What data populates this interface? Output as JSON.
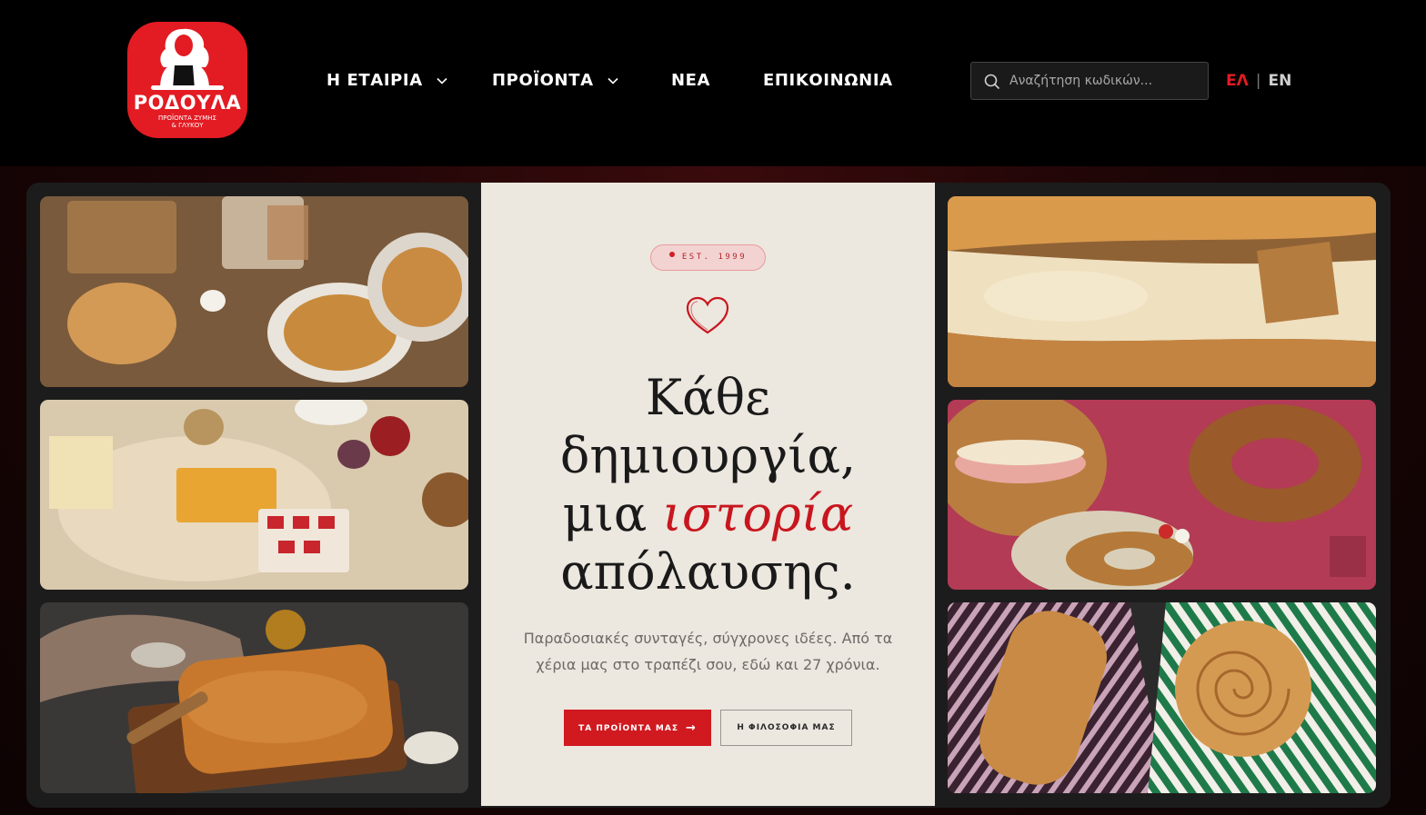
{
  "brand": {
    "name": "ΡΟΔΟΥΛΑ",
    "tagline_line1": "ΠΡΟΪΟΝΤΑ ΖΥΜΗΣ",
    "tagline_line2": "& ΓΛΥΚΟΥ",
    "color": "#e31b23"
  },
  "nav": {
    "items": [
      {
        "label": "Η ΕΤΑΙΡΙΑ",
        "has_dropdown": true
      },
      {
        "label": "ΠΡΟΪΟΝΤΑ",
        "has_dropdown": true
      },
      {
        "label": "ΝΕΑ",
        "has_dropdown": false
      },
      {
        "label": "ΕΠΙΚΟΙΝΩΝΙΑ",
        "has_dropdown": false
      }
    ]
  },
  "search": {
    "placeholder": "Αναζήτηση κωδικών...",
    "value": "",
    "icon": "search-icon"
  },
  "lang": {
    "active": "ΕΛ",
    "separator": "|",
    "other": "EN"
  },
  "hero": {
    "badge": "EST. 1999",
    "headline_line1": "Κάθε",
    "headline_line2": "δημιουργία,",
    "headline_line3_pre": "μια ",
    "headline_line3_highlight": "ιστορία",
    "headline_line4": "απόλαυσης.",
    "subtitle": "Παραδοσιακές συνταγές, σύγχρονες ιδέες. Από τα χέρια μας στο τραπέζι σου, εδώ και 27 χρόνια.",
    "primary_button": "ΤΑ ΠΡΟΪΟΝΤΑ ΜΑΣ",
    "secondary_button": "Η ΦΙΛΟΣΟΦΙΑ ΜΑΣ",
    "accent_color": "#c8161e",
    "panel_color": "#ece7df"
  }
}
